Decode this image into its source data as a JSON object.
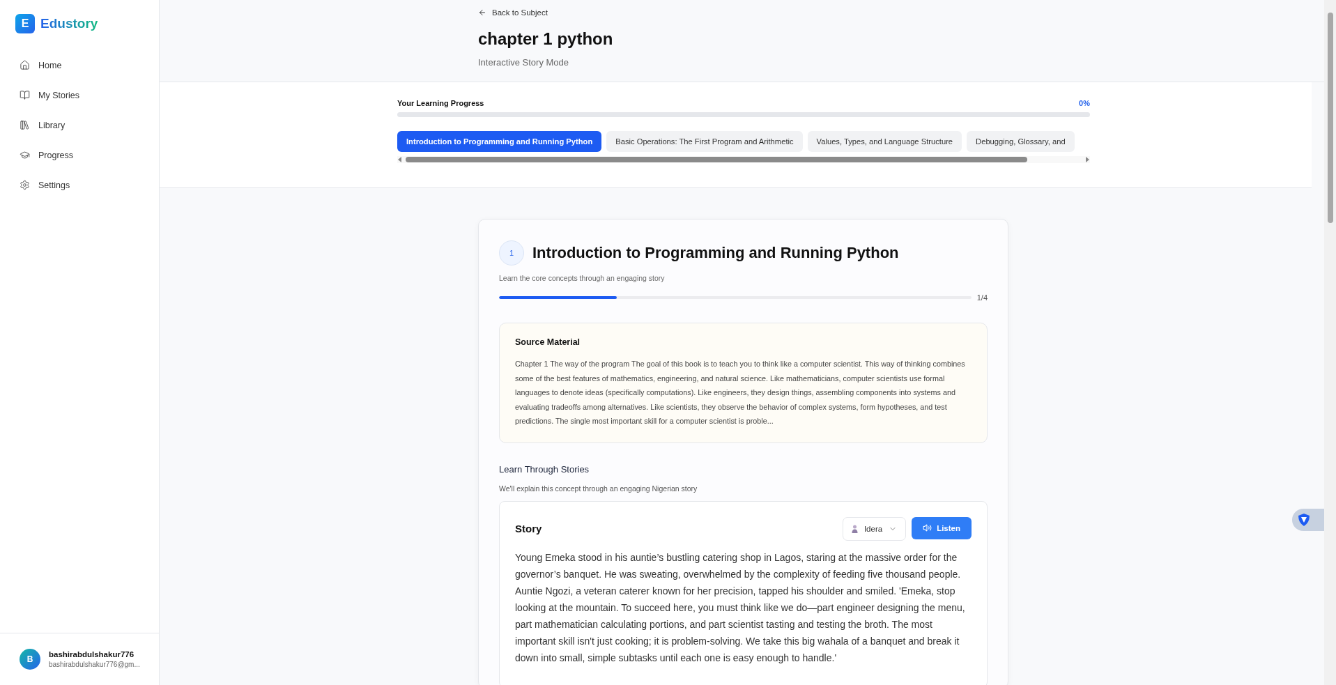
{
  "sidebar": {
    "logo": {
      "letter": "E",
      "name": "Edustory"
    },
    "items": [
      {
        "label": "Home"
      },
      {
        "label": "My Stories"
      },
      {
        "label": "Library"
      },
      {
        "label": "Progress"
      },
      {
        "label": "Settings"
      }
    ],
    "user": {
      "initial": "B",
      "name": "bashirabdulshakur776",
      "email": "bashirabdulshakur776@gm..."
    }
  },
  "header": {
    "back": "Back to Subject",
    "title": "chapter 1 python",
    "subtitle": "Interactive Story Mode"
  },
  "learning_progress": {
    "label": "Your Learning Progress",
    "reading": "0%"
  },
  "tabs": [
    {
      "label": "Introduction to Programming and Running Python",
      "selected": true
    },
    {
      "label": "Basic Operations: The First Program and Arithmetic",
      "selected": false
    },
    {
      "label": "Values, Types, and Language Structure",
      "selected": false
    },
    {
      "label": "Debugging, Glossary, and",
      "selected": false
    }
  ],
  "lesson": {
    "number": "1",
    "title": "Introduction to Programming and Running Python",
    "subtitle": "Learn the core concepts through an engaging story",
    "level": 0.25,
    "reading": "1/4",
    "source": {
      "title": "Source Material",
      "text": "Chapter 1 The way of the program The goal of this book is to teach you to think like a computer scientist. This way of thinking combines some of the best features of mathematics, engineering, and natural science. Like mathematicians, computer scientists use formal languages to denote ideas (specifically computations). Like engineers, they design things, assembling components into systems and evaluating tradeoffs among alternatives. Like scientists, they observe the behavior of complex systems, form hypotheses, and test predictions. The single most important skill for a computer scientist is proble..."
    },
    "stories_heading": "Learn Through Stories",
    "stories_subtitle": "We'll explain this concept through an engaging Nigerian story",
    "story": {
      "title": "Story",
      "voice": "Idera",
      "listen": "Listen",
      "text": "Young Emeka stood in his auntie’s bustling catering shop in Lagos, staring at the massive order for the governor’s banquet. He was sweating, overwhelmed by the complexity of feeding five thousand people. Auntie Ngozi, a veteran caterer known for her precision, tapped his shoulder and smiled. 'Emeka, stop looking at the mountain. To succeed here, you must think like we do—part engineer designing the menu, part mathematician calculating portions, and part scientist tasting and testing the broth. The most important skill isn't just cooking; it is problem-solving. We take this big wahala of a banquet and break it down into small, simple subtasks until each one is easy enough to handle.'"
    }
  }
}
